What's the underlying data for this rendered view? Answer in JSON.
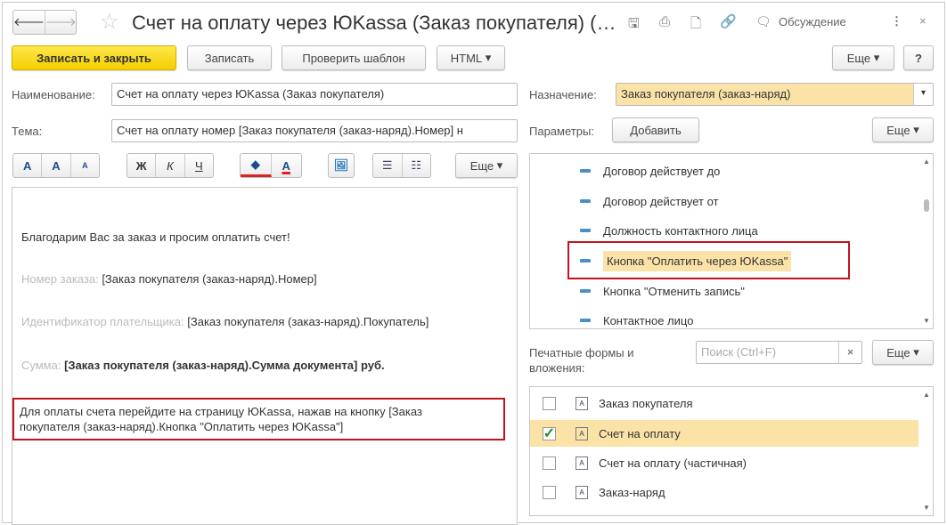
{
  "window": {
    "title": "Счет на оплату через ЮKassa (Заказ покупателя) (…",
    "discussion": "Обсуждение"
  },
  "toolbar": {
    "save_close": "Записать и закрыть",
    "save": "Записать",
    "check": "Проверить шаблон",
    "html": "HTML",
    "more": "Еще",
    "help": "?"
  },
  "form": {
    "name_label": "Наименование:",
    "name_value": "Счет на оплату через ЮKassa (Заказ покупателя)",
    "subject_label": "Тема:",
    "subject_value": "Счет на оплату номер [Заказ покупателя (заказ-наряд).Номер] н",
    "purpose_label": "Назначение:",
    "purpose_value": "Заказ покупателя (заказ-наряд)",
    "params_label": "Параметры:",
    "add": "Добавить",
    "more": "Еще"
  },
  "format": {
    "font_a": "A",
    "grow": "A",
    "shrink": "A",
    "bold": "Ж",
    "italic": "К",
    "underline": "Ч",
    "more": "Еще"
  },
  "body": {
    "greeting": "Благодарим Вас за заказ и просим оплатить счет!",
    "order_label": "Номер заказа:",
    "order_value": "[Заказ покупателя (заказ-наряд).Номер]",
    "payer_label": "Идентификатор плательщика:",
    "payer_value": "[Заказ покупателя (заказ-наряд).Покупатель]",
    "sum_label": "Сумма:",
    "sum_value": "[Заказ покупателя (заказ-наряд).Сумма документа] руб.",
    "pay_line1": "Для оплаты счета перейдите на страницу ЮKassa, нажав на кнопку [Заказ",
    "pay_line2": "покупателя (заказ-наряд).Кнопка \"Оплатить через ЮKassa\"]"
  },
  "params": [
    "Договор действует до",
    "Договор действует от",
    "Должность контактного лица",
    "Кнопка \"Оплатить через ЮKassa\"",
    "Кнопка \"Отменить запись\"",
    "Контактное лицо"
  ],
  "print": {
    "label1": "Печатные формы и",
    "label2": "вложения:",
    "search_placeholder": "Поиск (Ctrl+F)",
    "clear": "×",
    "more": "Еще",
    "items": [
      {
        "label": "Заказ покупателя",
        "checked": false
      },
      {
        "label": "Счет на оплату",
        "checked": true
      },
      {
        "label": "Счет на оплату (частичная)",
        "checked": false
      },
      {
        "label": "Заказ-наряд",
        "checked": false
      }
    ]
  }
}
